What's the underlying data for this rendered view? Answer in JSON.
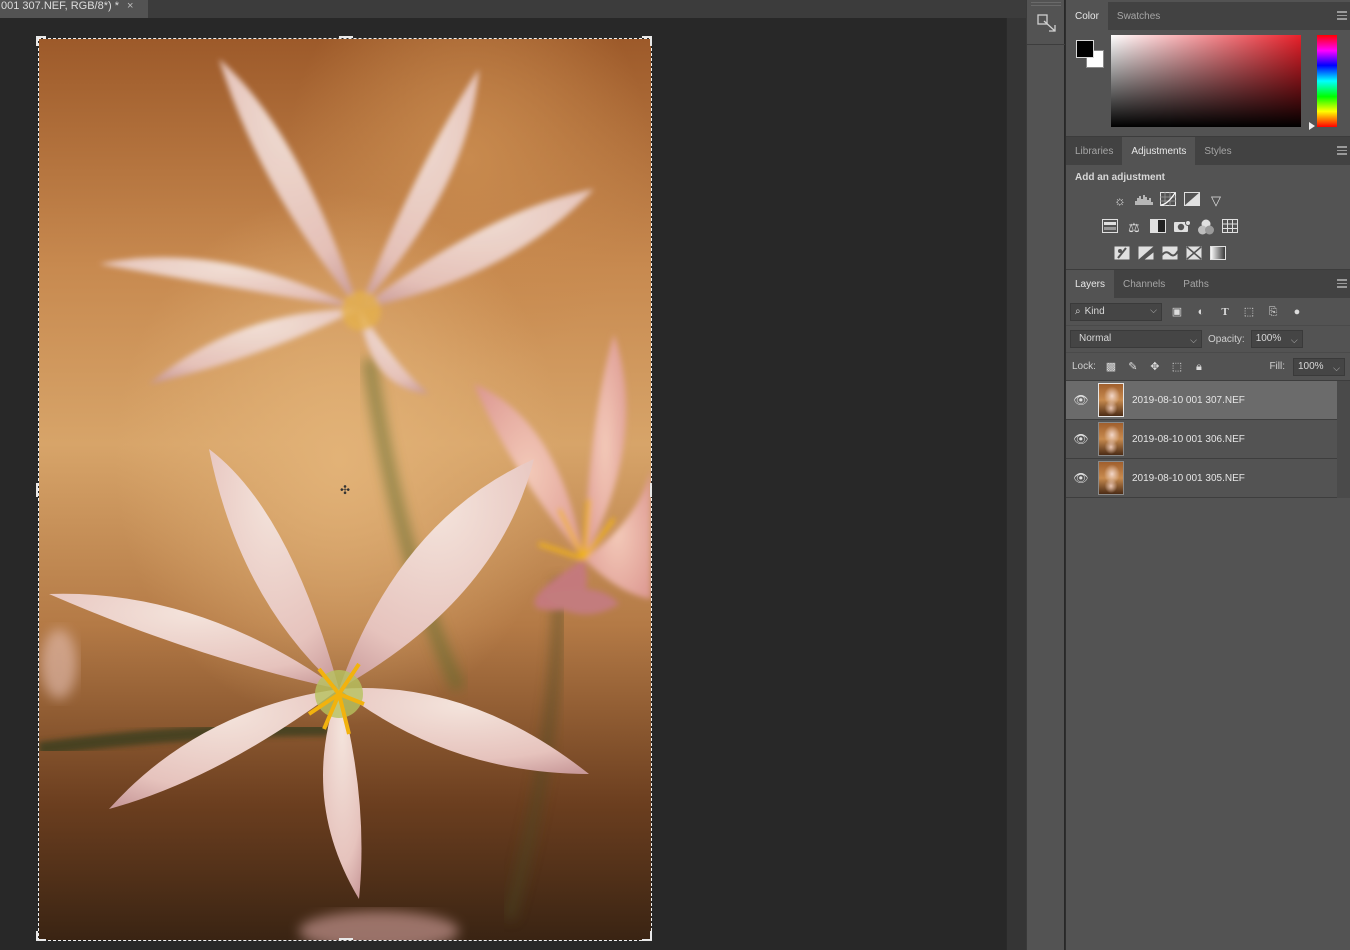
{
  "document": {
    "tab_title": "001 307.NEF, RGB/8*) *",
    "close_glyph": "×"
  },
  "color_panel": {
    "tabs": [
      "Color",
      "Swatches"
    ],
    "foreground_color": "#000000",
    "background_color": "#ffffff"
  },
  "adjustments_panel": {
    "tabs": [
      "Libraries",
      "Adjustments",
      "Styles"
    ],
    "title": "Add an adjustment",
    "icon_rows": [
      [
        "brightness-contrast-icon",
        "levels-icon",
        "curves-icon",
        "exposure-icon",
        "vibrance-icon"
      ],
      [
        "hue-saturation-icon",
        "color-balance-icon",
        "black-white-icon",
        "photo-filter-icon",
        "channel-mixer-icon",
        "color-lookup-icon"
      ],
      [
        "invert-icon",
        "posterize-icon",
        "threshold-icon",
        "selective-color-icon",
        "gradient-map-icon"
      ]
    ]
  },
  "layers_panel": {
    "tabs": [
      "Layers",
      "Channels",
      "Paths"
    ],
    "kind_label": "Kind",
    "blend_mode": "Normal",
    "opacity_label": "Opacity:",
    "opacity_value": "100%",
    "lock_label": "Lock:",
    "fill_label": "Fill:",
    "fill_value": "100%",
    "layers": [
      {
        "name": "2019-08-10 001 307.NEF",
        "visible": true,
        "selected": true
      },
      {
        "name": "2019-08-10 001 306.NEF",
        "visible": true,
        "selected": false
      },
      {
        "name": "2019-08-10 001 305.NEF",
        "visible": true,
        "selected": false
      }
    ]
  }
}
